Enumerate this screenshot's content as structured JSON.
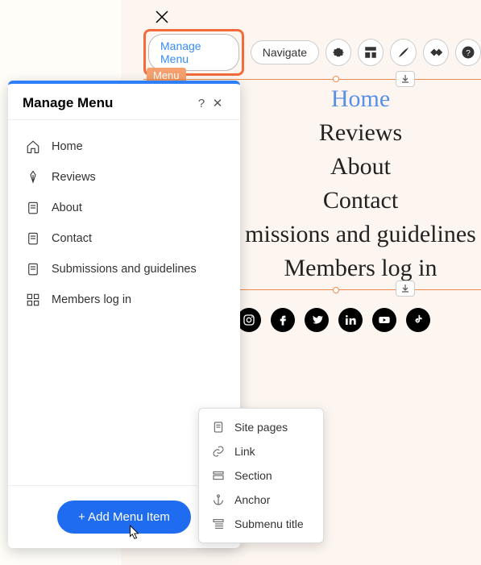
{
  "top": {
    "close_icon": "×",
    "manage_menu": "Manage Menu",
    "navigate": "Navigate",
    "menu_tag": "Menu"
  },
  "canvas_nav": [
    "Home",
    "Reviews",
    "About",
    "Contact",
    "missions and guidelines",
    "Members log in"
  ],
  "social_icons": [
    "instagram",
    "facebook",
    "twitter",
    "linkedin",
    "youtube",
    "tiktok"
  ],
  "panel": {
    "title": "Manage Menu",
    "items": [
      {
        "icon": "home",
        "label": "Home"
      },
      {
        "icon": "pen",
        "label": "Reviews"
      },
      {
        "icon": "page",
        "label": "About"
      },
      {
        "icon": "page",
        "label": "Contact"
      },
      {
        "icon": "page",
        "label": "Submissions and guidelines"
      },
      {
        "icon": "grid",
        "label": "Members log in"
      }
    ],
    "add_btn": "+ Add Menu Item"
  },
  "dropdown": [
    {
      "icon": "page",
      "label": "Site pages"
    },
    {
      "icon": "link",
      "label": "Link"
    },
    {
      "icon": "section",
      "label": "Section"
    },
    {
      "icon": "anchor",
      "label": "Anchor"
    },
    {
      "icon": "submenu",
      "label": "Submenu title"
    }
  ]
}
